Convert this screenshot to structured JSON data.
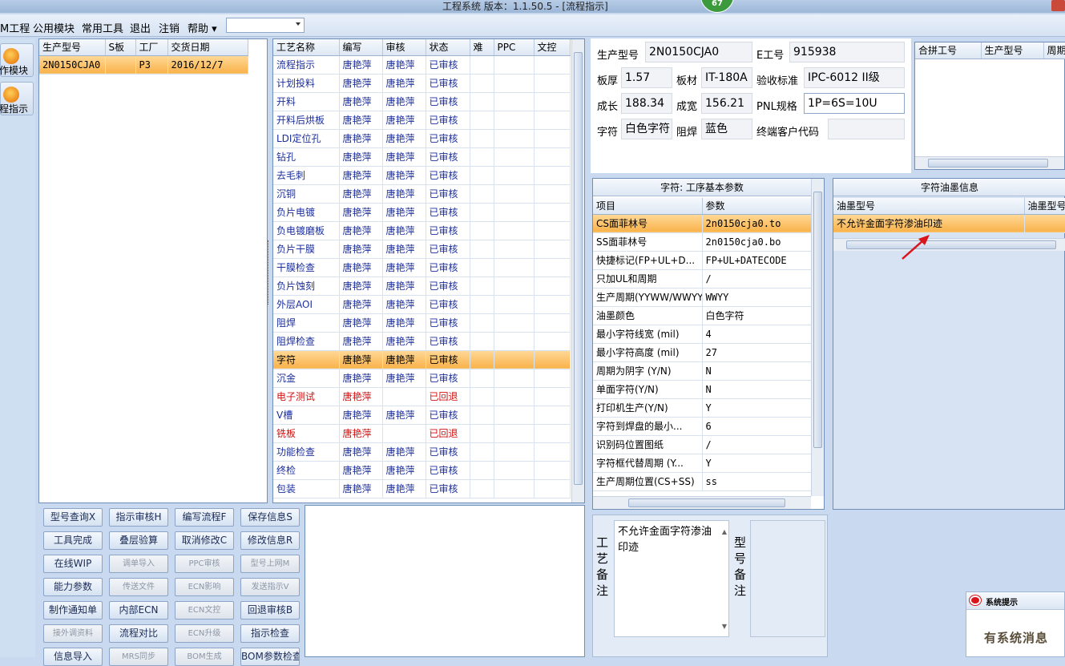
{
  "window": {
    "title": "工程系统   版本：1.1.50.5 - [流程指示]",
    "badge": "67"
  },
  "menubar": {
    "items": [
      "M工程",
      "公用模块",
      "常用工具",
      "退出",
      "注销",
      "帮助 ▾"
    ],
    "combo_value": ""
  },
  "leftnav": {
    "items": [
      {
        "label": "作模块",
        "icon": "flame-icon"
      },
      {
        "label": "程指示",
        "icon": "pause-circle-icon"
      }
    ]
  },
  "models": {
    "headers": [
      "生产型号",
      "S板",
      "工厂",
      "交货日期"
    ],
    "rows": [
      [
        "2N0150CJA0",
        "",
        "P3",
        "2016/12/7"
      ]
    ]
  },
  "process": {
    "headers": [
      "工艺名称",
      "编写",
      "审核",
      "状态",
      "难",
      "PPC",
      "文控"
    ],
    "rows": [
      {
        "name": "流程指示",
        "writer": "唐艳萍",
        "reviewer": "唐艳萍",
        "status": "已审核",
        "style": "blue"
      },
      {
        "name": "计划投料",
        "writer": "唐艳萍",
        "reviewer": "唐艳萍",
        "status": "已审核",
        "style": "blue"
      },
      {
        "name": "开料",
        "writer": "唐艳萍",
        "reviewer": "唐艳萍",
        "status": "已审核",
        "style": "blue"
      },
      {
        "name": "开料后烘板",
        "writer": "唐艳萍",
        "reviewer": "唐艳萍",
        "status": "已审核",
        "style": "blue"
      },
      {
        "name": "LDI定位孔",
        "writer": "唐艳萍",
        "reviewer": "唐艳萍",
        "status": "已审核",
        "style": "blue"
      },
      {
        "name": "钻孔",
        "writer": "唐艳萍",
        "reviewer": "唐艳萍",
        "status": "已审核",
        "style": "blue"
      },
      {
        "name": "去毛刺",
        "writer": "唐艳萍",
        "reviewer": "唐艳萍",
        "status": "已审核",
        "style": "blue"
      },
      {
        "name": "沉铜",
        "writer": "唐艳萍",
        "reviewer": "唐艳萍",
        "status": "已审核",
        "style": "blue"
      },
      {
        "name": "负片电镀",
        "writer": "唐艳萍",
        "reviewer": "唐艳萍",
        "status": "已审核",
        "style": "blue"
      },
      {
        "name": "负电镀磨板",
        "writer": "唐艳萍",
        "reviewer": "唐艳萍",
        "status": "已审核",
        "style": "blue"
      },
      {
        "name": "负片干膜",
        "writer": "唐艳萍",
        "reviewer": "唐艳萍",
        "status": "已审核",
        "style": "blue"
      },
      {
        "name": "干膜检查",
        "writer": "唐艳萍",
        "reviewer": "唐艳萍",
        "status": "已审核",
        "style": "blue"
      },
      {
        "name": "负片蚀刻",
        "writer": "唐艳萍",
        "reviewer": "唐艳萍",
        "status": "已审核",
        "style": "blue"
      },
      {
        "name": "外层AOI",
        "writer": "唐艳萍",
        "reviewer": "唐艳萍",
        "status": "已审核",
        "style": "blue"
      },
      {
        "name": "阻焊",
        "writer": "唐艳萍",
        "reviewer": "唐艳萍",
        "status": "已审核",
        "style": "blue"
      },
      {
        "name": "阻焊检查",
        "writer": "唐艳萍",
        "reviewer": "唐艳萍",
        "status": "已审核",
        "style": "blue"
      },
      {
        "name": "字符",
        "writer": "唐艳萍",
        "reviewer": "唐艳萍",
        "status": "已审核",
        "style": "selected"
      },
      {
        "name": "沉金",
        "writer": "唐艳萍",
        "reviewer": "唐艳萍",
        "status": "已审核",
        "style": "blue"
      },
      {
        "name": "电子测试",
        "writer": "唐艳萍",
        "reviewer": "",
        "status": "已回退",
        "style": "red"
      },
      {
        "name": "V槽",
        "writer": "唐艳萍",
        "reviewer": "唐艳萍",
        "status": "已审核",
        "style": "blue"
      },
      {
        "name": "铣板",
        "writer": "唐艳萍",
        "reviewer": "",
        "status": "已回退",
        "style": "red"
      },
      {
        "name": "功能检查",
        "writer": "唐艳萍",
        "reviewer": "唐艳萍",
        "status": "已审核",
        "style": "blue"
      },
      {
        "name": "终检",
        "writer": "唐艳萍",
        "reviewer": "唐艳萍",
        "status": "已审核",
        "style": "blue"
      },
      {
        "name": "包装",
        "writer": "唐艳萍",
        "reviewer": "唐艳萍",
        "status": "已审核",
        "style": "blue"
      }
    ]
  },
  "actions": {
    "rows": [
      [
        {
          "label": "型号查询X",
          "enabled": true
        },
        {
          "label": "指示审核H",
          "enabled": true
        },
        {
          "label": "编写流程F",
          "enabled": true
        },
        {
          "label": "保存信息S",
          "enabled": true
        }
      ],
      [
        {
          "label": "工具完成",
          "enabled": true
        },
        {
          "label": "叠层验算",
          "enabled": true
        },
        {
          "label": "取消修改C",
          "enabled": true
        },
        {
          "label": "修改信息R",
          "enabled": true
        }
      ],
      [
        {
          "label": "在线WIP",
          "enabled": true
        },
        {
          "label": "调单导入",
          "enabled": false
        },
        {
          "label": "PPC审核",
          "enabled": false
        },
        {
          "label": "型号上网M",
          "enabled": false
        }
      ],
      [
        {
          "label": "能力参数",
          "enabled": true
        },
        {
          "label": "传送文件",
          "enabled": false
        },
        {
          "label": "ECN影响",
          "enabled": false
        },
        {
          "label": "发送指示V",
          "enabled": false
        }
      ],
      [
        {
          "label": "制作通知单",
          "enabled": true
        },
        {
          "label": "内部ECN",
          "enabled": true
        },
        {
          "label": "ECN文控",
          "enabled": false
        },
        {
          "label": "回退审核B",
          "enabled": true
        }
      ],
      [
        {
          "label": "接外调资料",
          "enabled": false
        },
        {
          "label": "流程对比",
          "enabled": true
        },
        {
          "label": "ECN升级",
          "enabled": false
        },
        {
          "label": "指示检查",
          "enabled": true
        }
      ],
      [
        {
          "label": "信息导入",
          "enabled": true
        },
        {
          "label": "MRS同步",
          "enabled": false
        },
        {
          "label": "BOM生成",
          "enabled": false
        },
        {
          "label": "BOM参数检查",
          "enabled": true
        }
      ]
    ]
  },
  "info": {
    "model_label": "生产型号",
    "model_value": "2N0150CJA0",
    "e_label": "E工号",
    "e_value": "915938",
    "thickness_label": "板厚",
    "thickness_value": "1.57",
    "material_label": "板材",
    "material_value": "IT-180A",
    "standard_label": "验收标准",
    "standard_value": "IPC-6012 II级",
    "length_label": "成长",
    "length_value": "188.34",
    "width_label": "成宽",
    "width_value": "156.21",
    "pnl_label": "PNL规格",
    "pnl_value": "1P=6S=10U",
    "char_label": "字符",
    "char_value": "白色字符",
    "mask_label": "阻焊",
    "mask_value": "蓝色",
    "customer_label": "终端客户代码",
    "customer_value": ""
  },
  "combine": {
    "headers": [
      "合拼工号",
      "生产型号",
      "周期"
    ]
  },
  "params": {
    "title": "字符: 工序基本参数",
    "headers": [
      "项目",
      "参数"
    ],
    "rows": [
      [
        "CS面菲林号",
        "2n0150cja0.to"
      ],
      [
        "SS面菲林号",
        "2n0150cja0.bo"
      ],
      [
        "快捷标记(FP+UL+D...",
        "FP+UL+DATECODE"
      ],
      [
        "只加UL和周期",
        "/"
      ],
      [
        "生产周期(YYWW/WWYY)",
        "WWYY"
      ],
      [
        "油墨颜色",
        "白色字符"
      ],
      [
        "最小字符线宽 (mil)",
        "4"
      ],
      [
        "最小字符高度 (mil)",
        "27"
      ],
      [
        "周期为阴字 (Y/N)",
        "N"
      ],
      [
        "单面字符(Y/N)",
        "N"
      ],
      [
        "打印机生产(Y/N)",
        "Y"
      ],
      [
        "字符到焊盘的最小...",
        "6"
      ],
      [
        "识别码位置图纸",
        "/"
      ],
      [
        "字符框代替周期 (Y...",
        "Y"
      ],
      [
        "生产周期位置(CS+SS)",
        "ss"
      ]
    ]
  },
  "ink": {
    "title": "字符油墨信息",
    "headers": [
      "油墨型号",
      "油墨型号"
    ],
    "rows": [
      [
        "不允许金面字符渗油印迹",
        ""
      ]
    ]
  },
  "remarks": {
    "process_label": [
      "工",
      "艺",
      "备",
      "注"
    ],
    "process_text": "不允许金面字符渗油印迹",
    "model_label": [
      "型",
      "号",
      "备",
      "注"
    ],
    "model_text": ""
  },
  "popup": {
    "title": "系统提示",
    "message": "有系统消息"
  },
  "colors": {
    "accent": "#f9b24a",
    "link_blue": "#1c2f9c",
    "error_red": "#d21010",
    "arrow": "#d9141a"
  }
}
